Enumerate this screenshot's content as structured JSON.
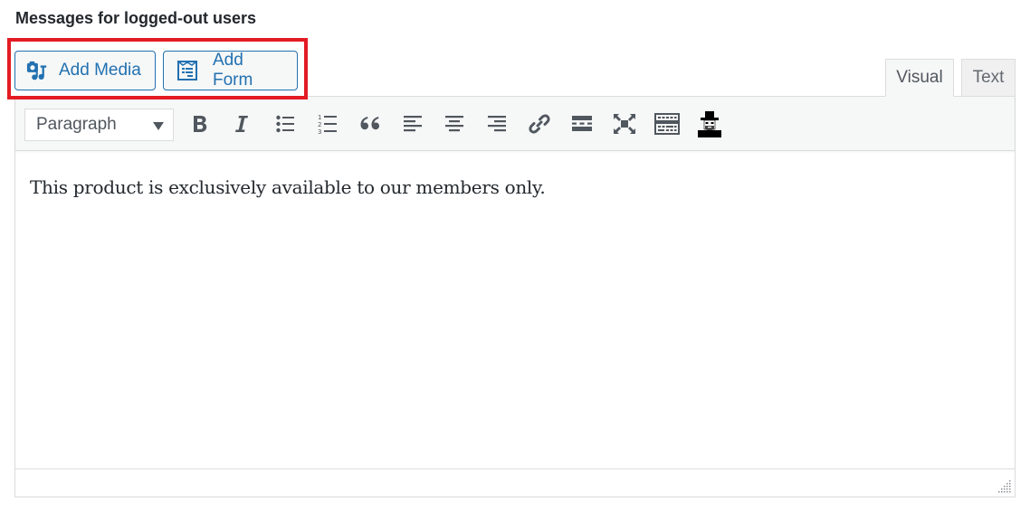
{
  "section": {
    "title": "Messages for logged-out users"
  },
  "media_buttons": [
    {
      "label": "Add Media",
      "icon": "media-camera-music-icon"
    },
    {
      "label": "Add Form",
      "icon": "form-icon"
    }
  ],
  "highlight": {
    "color": "#e31b23"
  },
  "tabs": [
    {
      "label": "Visual",
      "active": true
    },
    {
      "label": "Text",
      "active": false
    }
  ],
  "toolbar": {
    "format_select": {
      "value": "Paragraph"
    },
    "buttons": [
      {
        "name": "bold",
        "icon": "bold-icon"
      },
      {
        "name": "italic",
        "icon": "italic-icon"
      },
      {
        "name": "bulleted-list",
        "icon": "bulleted-list-icon"
      },
      {
        "name": "numbered-list",
        "icon": "numbered-list-icon"
      },
      {
        "name": "blockquote",
        "icon": "blockquote-icon"
      },
      {
        "name": "align-left",
        "icon": "align-left-icon"
      },
      {
        "name": "align-center",
        "icon": "align-center-icon"
      },
      {
        "name": "align-right",
        "icon": "align-right-icon"
      },
      {
        "name": "insert-link",
        "icon": "link-icon"
      },
      {
        "name": "read-more",
        "icon": "read-more-icon"
      },
      {
        "name": "fullscreen",
        "icon": "fullscreen-icon"
      },
      {
        "name": "toolbar-toggle",
        "icon": "keyboard-icon"
      },
      {
        "name": "plugin-avatar",
        "icon": "man-with-hat-icon"
      }
    ]
  },
  "editor": {
    "content": "This product is exclusively available to our members only."
  },
  "colors": {
    "accent": "#2271b1",
    "text": "#23282d",
    "icon": "#50575e",
    "border": "#dcdcde",
    "toolbar_bg": "#f6f7f7"
  }
}
